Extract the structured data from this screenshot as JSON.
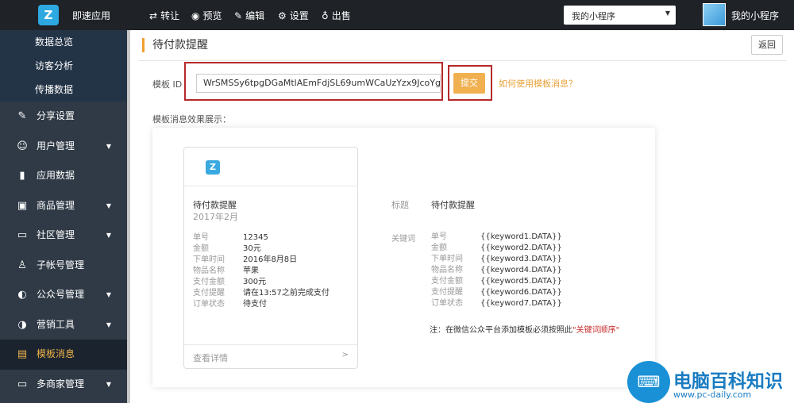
{
  "header": {
    "logo_letter": "Z",
    "app_name": "即速应用",
    "toolbar": [
      {
        "icon": "⇄",
        "label": "转让"
      },
      {
        "icon": "◉",
        "label": "预览"
      },
      {
        "icon": "✎",
        "label": "编辑"
      },
      {
        "icon": "⚙",
        "label": "设置"
      },
      {
        "icon": "♁",
        "label": "出售"
      }
    ],
    "app_select": "我的小程序",
    "user_name": "我的小程序"
  },
  "sidebar": {
    "subitems": [
      "数据总览",
      "访客分析",
      "传播数据"
    ],
    "items": [
      {
        "icon": "✎",
        "label": "分享设置",
        "has_caret": false,
        "active": false
      },
      {
        "icon": "☺",
        "label": "用户管理",
        "has_caret": true,
        "active": false
      },
      {
        "icon": "▮",
        "label": "应用数据",
        "has_caret": false,
        "active": false
      },
      {
        "icon": "▣",
        "label": "商品管理",
        "has_caret": true,
        "active": false
      },
      {
        "icon": "▭",
        "label": "社区管理",
        "has_caret": true,
        "active": false
      },
      {
        "icon": "♙",
        "label": "子帐号管理",
        "has_caret": false,
        "active": false
      },
      {
        "icon": "◐",
        "label": "公众号管理",
        "has_caret": true,
        "active": false
      },
      {
        "icon": "◑",
        "label": "营销工具",
        "has_caret": true,
        "active": false
      },
      {
        "icon": "▤",
        "label": "模板消息",
        "has_caret": false,
        "active": true
      },
      {
        "icon": "▭",
        "label": "多商家管理",
        "has_caret": true,
        "active": false
      }
    ]
  },
  "main": {
    "page_title": "待付款提醒",
    "back_label": "返回",
    "template_id_label": "模板 ID",
    "template_id_value": "WrSMSSy6tpgDGaMtlAEmFdjSL69umWCaUzYzx9JcoYg",
    "submit_label": "提交",
    "howto_link": "如何使用模板消息？",
    "preview_label": "模板消息效果展示：",
    "card": {
      "logo_letter": "Z",
      "title": "待付款提醒",
      "date": "2017年2月",
      "rows": [
        {
          "k": "单号",
          "v": "12345"
        },
        {
          "k": "金额",
          "v": "30元"
        },
        {
          "k": "下单时间",
          "v": "2016年8月8日"
        },
        {
          "k": "物品名称",
          "v": "苹果"
        },
        {
          "k": "支付金额",
          "v": "300元"
        },
        {
          "k": "支付提醒",
          "v": "请在13:57之前完成支付"
        },
        {
          "k": "订单状态",
          "v": "待支付"
        }
      ],
      "footer": "查看详情",
      "footer_arrow": ">"
    },
    "detail": {
      "title_key": "标题",
      "title_value": "待付款提醒",
      "keywords_key": "关键词",
      "keywords": [
        {
          "k": "单号",
          "v": "{{keyword1.DATA}}"
        },
        {
          "k": "金额",
          "v": "{{keyword2.DATA}}"
        },
        {
          "k": "下单时间",
          "v": "{{keyword3.DATA}}"
        },
        {
          "k": "物品名称",
          "v": "{{keyword4.DATA}}"
        },
        {
          "k": "支付金额",
          "v": "{{keyword5.DATA}}"
        },
        {
          "k": "支付提醒",
          "v": "{{keyword6.DATA}}"
        },
        {
          "k": "订单状态",
          "v": "{{keyword7.DATA}}"
        }
      ],
      "note_prefix": "注：在微信公众平台添加模板必须按照此",
      "note_highlight": "\"关键词顺序\""
    }
  },
  "watermark": {
    "title": "电脑百科知识",
    "url": "www.pc-daily.com"
  },
  "colors": {
    "topbar": "#1f2227",
    "sidebar": "#2f3a46",
    "accent": "#f0b050",
    "highlight_box": "#b52a2a",
    "link": "#e8a23a"
  }
}
